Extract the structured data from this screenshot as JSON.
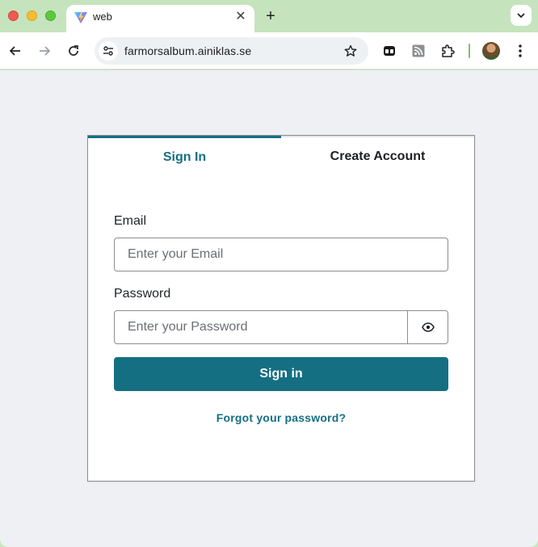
{
  "browser": {
    "tab_title": "web",
    "url": "farmorsalbum.ainiklas.se",
    "colors": {
      "frame": "#c5e4bd",
      "accent": "#156f83"
    }
  },
  "icons": {
    "back": "back-arrow-icon",
    "forward": "forward-arrow-icon",
    "reload": "reload-icon",
    "site_info": "site-settings-icon",
    "bookmark": "star-icon",
    "extensions": [
      "tab-manager-icon",
      "rss-icon",
      "puzzle-icon"
    ],
    "menu": "kebab-menu-icon"
  },
  "auth": {
    "tabs": [
      {
        "label": "Sign In",
        "active": true
      },
      {
        "label": "Create Account",
        "active": false
      }
    ],
    "email": {
      "label": "Email",
      "placeholder": "Enter your Email",
      "value": ""
    },
    "password": {
      "label": "Password",
      "placeholder": "Enter your Password",
      "value": ""
    },
    "submit_label": "Sign in",
    "forgot_label": "Forgot your password?"
  }
}
